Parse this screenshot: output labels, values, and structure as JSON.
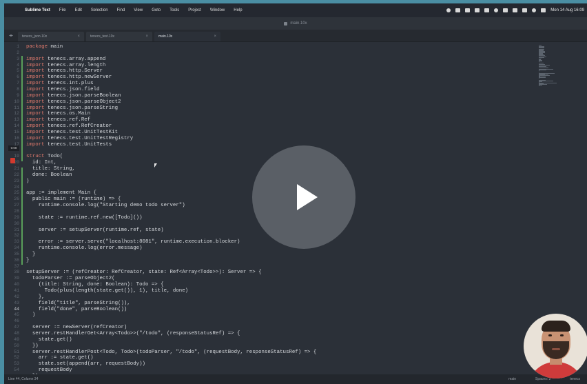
{
  "menubar": {
    "apple": "",
    "app_name": "Sublime Text",
    "menus": [
      "File",
      "Edit",
      "Selection",
      "Find",
      "View",
      "Goto",
      "Tools",
      "Project",
      "Window",
      "Help"
    ],
    "clock": "Mon 14 Aug 16:09"
  },
  "window": {
    "title": "main.10x"
  },
  "tabs": [
    {
      "label": "tenecs_json.10x",
      "active": false
    },
    {
      "label": "tenecs_test.10x",
      "active": false
    },
    {
      "label": "main.10x",
      "active": true
    }
  ],
  "editor": {
    "fold_marker": "0:08",
    "current_line": "44",
    "line_numbers": [
      "1",
      "2",
      "3",
      "4",
      "5",
      "6",
      "7",
      "8",
      "9",
      "10",
      "11",
      "12",
      "13",
      "14",
      "15",
      "16",
      "17",
      "18",
      "19",
      "20",
      "21",
      "22",
      "23",
      "24",
      "25",
      "26",
      "27",
      "28",
      "29",
      "30",
      "31",
      "32",
      "33",
      "34",
      "35",
      "36",
      "37",
      "38",
      "39",
      "40",
      "41",
      "42",
      "43",
      "44",
      "45",
      "46",
      "47",
      "48",
      "49",
      "50",
      "51",
      "52",
      "53",
      "54"
    ],
    "lines": [
      {
        "kw": "package",
        "rest": " main"
      },
      {
        "kw": "",
        "rest": ""
      },
      {
        "kw": "import",
        "rest": " tenecs.array.append"
      },
      {
        "kw": "import",
        "rest": " tenecs.array.length"
      },
      {
        "kw": "import",
        "rest": " tenecs.http.Server"
      },
      {
        "kw": "import",
        "rest": " tenecs.http.newServer"
      },
      {
        "kw": "import",
        "rest": " tenecs.int.plus"
      },
      {
        "kw": "import",
        "rest": " tenecs.json.field"
      },
      {
        "kw": "import",
        "rest": " tenecs.json.parseBoolean"
      },
      {
        "kw": "import",
        "rest": " tenecs.json.parseObject2"
      },
      {
        "kw": "import",
        "rest": " tenecs.json.parseString"
      },
      {
        "kw": "import",
        "rest": " tenecs.os.Main"
      },
      {
        "kw": "import",
        "rest": " tenecs.ref.Ref"
      },
      {
        "kw": "import",
        "rest": " tenecs.ref.RefCreator"
      },
      {
        "kw": "import",
        "rest": " tenecs.test.UnitTestKit"
      },
      {
        "kw": "import",
        "rest": " tenecs.test.UnitTestRegistry"
      },
      {
        "kw": "import",
        "rest": " tenecs.test.UnitTests"
      },
      {
        "kw": "",
        "rest": ""
      },
      {
        "kw": "struct",
        "rest": " Todo("
      },
      {
        "kw": "",
        "rest": "  id: Int,"
      },
      {
        "kw": "",
        "rest": "  title: String,"
      },
      {
        "kw": "",
        "rest": "  done: Boolean"
      },
      {
        "kw": "",
        "rest": ")"
      },
      {
        "kw": "",
        "rest": ""
      },
      {
        "kw": "",
        "rest": "app := implement Main {"
      },
      {
        "kw": "",
        "rest": "  public main := (runtime) => {"
      },
      {
        "kw": "",
        "rest": "    runtime.console.log(\"Starting demo todo server\")"
      },
      {
        "kw": "",
        "rest": ""
      },
      {
        "kw": "",
        "rest": "    state := runtime.ref.new([Todo]())"
      },
      {
        "kw": "",
        "rest": ""
      },
      {
        "kw": "",
        "rest": "    server := setupServer(runtime.ref, state)"
      },
      {
        "kw": "",
        "rest": ""
      },
      {
        "kw": "",
        "rest": "    error := server.serve(\"localhost:8081\", runtime.execution.blocker)"
      },
      {
        "kw": "",
        "rest": "    runtime.console.log(error.message)"
      },
      {
        "kw": "",
        "rest": "  }"
      },
      {
        "kw": "",
        "rest": "}"
      },
      {
        "kw": "",
        "rest": ""
      },
      {
        "kw": "",
        "rest": "setupServer := (refCreator: RefCreator, state: Ref<Array<Todo>>): Server => {"
      },
      {
        "kw": "",
        "rest": "  todoParser := parseObject2("
      },
      {
        "kw": "",
        "rest": "    (title: String, done: Boolean): Todo => {"
      },
      {
        "kw": "",
        "rest": "      Todo(plus(length(state.get()), 1), title, done)"
      },
      {
        "kw": "",
        "rest": "    },"
      },
      {
        "kw": "",
        "rest": "    field(\"title\", parseString()),"
      },
      {
        "kw": "",
        "rest": "    field(\"done\", parseBoolean())"
      },
      {
        "kw": "",
        "rest": "  )"
      },
      {
        "kw": "",
        "rest": ""
      },
      {
        "kw": "",
        "rest": "  server := newServer(refCreator)"
      },
      {
        "kw": "",
        "rest": "  server.restHandlerGet<Array<Todo>>(\"/todo\", (responseStatusRef) => {"
      },
      {
        "kw": "",
        "rest": "    state.get()"
      },
      {
        "kw": "",
        "rest": "  })"
      },
      {
        "kw": "",
        "rest": "  server.restHandlerPost<Todo, Todo>(todoParser, \"/todo\", (requestBody, responseStatusRef) => {"
      },
      {
        "kw": "",
        "rest": "    arr := state.get()"
      },
      {
        "kw": "",
        "rest": "    state.set(append(arr, requestBody))"
      },
      {
        "kw": "",
        "rest": "    requestBody"
      },
      {
        "kw": "",
        "rest": "  })"
      }
    ]
  },
  "statusbar": {
    "position": "Line 44, Column 34",
    "branch": "main",
    "spaces": "Spaces: 2",
    "syntax": "tenecs"
  }
}
